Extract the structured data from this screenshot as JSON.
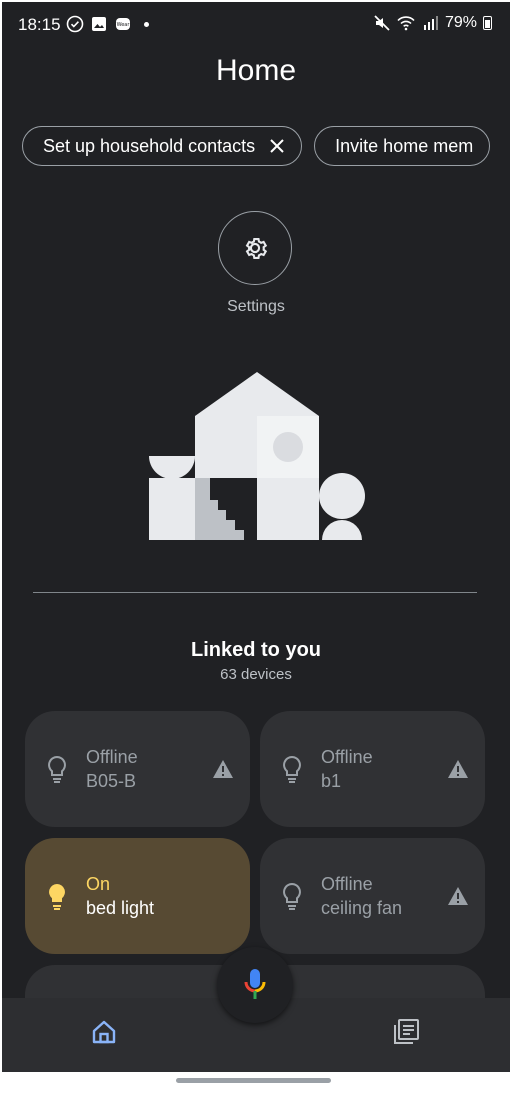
{
  "status_bar": {
    "time": "18:15",
    "battery": "79%",
    "icons": [
      "check-circle-icon",
      "gallery-icon",
      "wear-icon",
      "notification-dot-icon",
      "mute-icon",
      "wifi-icon",
      "signal-icon",
      "battery-icon"
    ]
  },
  "header": {
    "title": "Home"
  },
  "chips": [
    {
      "label": "Set up household contacts",
      "icon": "close-icon"
    },
    {
      "label": "Invite home mem"
    }
  ],
  "settings": {
    "label": "Settings",
    "icon": "gear-icon"
  },
  "linked": {
    "title": "Linked to you",
    "count": "63 devices"
  },
  "devices": [
    {
      "state": "Offline",
      "name": "B05-B",
      "icon": "lightbulb-icon",
      "warning": true
    },
    {
      "state": "Offline",
      "name": "b1",
      "icon": "lightbulb-icon",
      "warning": true
    },
    {
      "state": "On",
      "name": "bed light",
      "icon": "lightbulb-icon",
      "warning": false
    },
    {
      "state": "Offline",
      "name": "ceiling fan",
      "icon": "lightbulb-icon",
      "warning": true
    }
  ],
  "bottom_nav": {
    "items": [
      "home-icon",
      "feed-icon"
    ],
    "mic_icon": "mic-icon"
  },
  "colors": {
    "background": "#202124",
    "tile": "#303134",
    "tile_on": "#574a33",
    "on_text": "#fdd663",
    "nav_active": "#8ab4f8"
  }
}
